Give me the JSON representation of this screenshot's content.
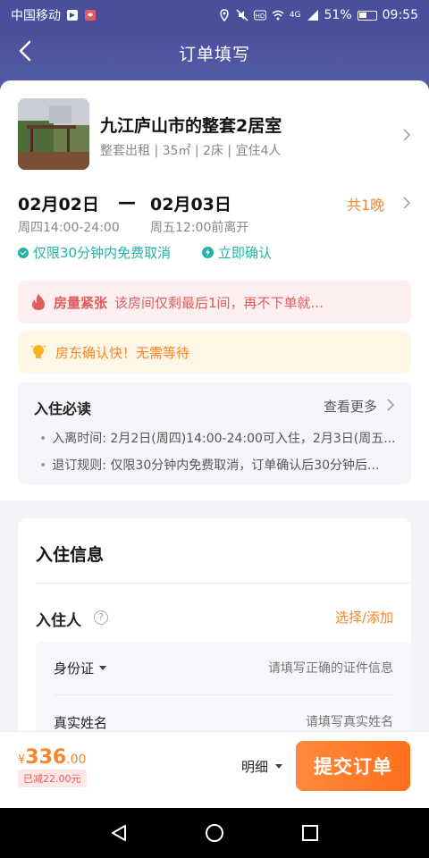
{
  "status": {
    "carrier": "中国移动",
    "signal_text": "4G",
    "battery": "51%",
    "time": "09:55"
  },
  "nav": {
    "title": "订单填写"
  },
  "listing": {
    "title": "九江庐山市的整套2居室",
    "subtitle": "整套出租 | 35㎡ | 2床 | 宜住4人"
  },
  "dates": {
    "checkin": "02月02日",
    "dash": "—",
    "checkout": "02月03日",
    "checkin_sub": "周四14:00-24:00",
    "checkout_sub": "周五12:00前离开",
    "nights": "共1晚"
  },
  "tags": {
    "cancel": "仅限30分钟内免费取消",
    "instant": "立即确认"
  },
  "alerts": {
    "red_strong": "房量紧张",
    "red_text": "该房间仅剩最后1间，再不下单就...",
    "yellow_text": "房东确认快！无需等待"
  },
  "must_read": {
    "title": "入住必读",
    "more": "查看更多",
    "lines": [
      "入离时间: 2月2日(周四)14:00-24:00可入住，2月3日(周五...",
      "退订规则: 仅限30分钟内免费取消，订单确认后30分钟后..."
    ]
  },
  "checkin_info": {
    "title": "入住信息",
    "guest_label": "入住人",
    "help": "?",
    "select_add": "选择/添加",
    "id_label": "身份证",
    "id_placeholder": "请填写正确的证件信息",
    "name_label": "真实姓名",
    "name_placeholder": "请填写真实姓名"
  },
  "bottom": {
    "yen": "¥",
    "price_int": "336",
    "price_dec": ".00",
    "discount": "已减22.00元",
    "detail": "明细",
    "submit": "提交订单"
  },
  "colors": {
    "accent": "#f5862c",
    "teal": "#22b3a6",
    "header": "#4a4f9c",
    "warn": "#e25b5d"
  }
}
